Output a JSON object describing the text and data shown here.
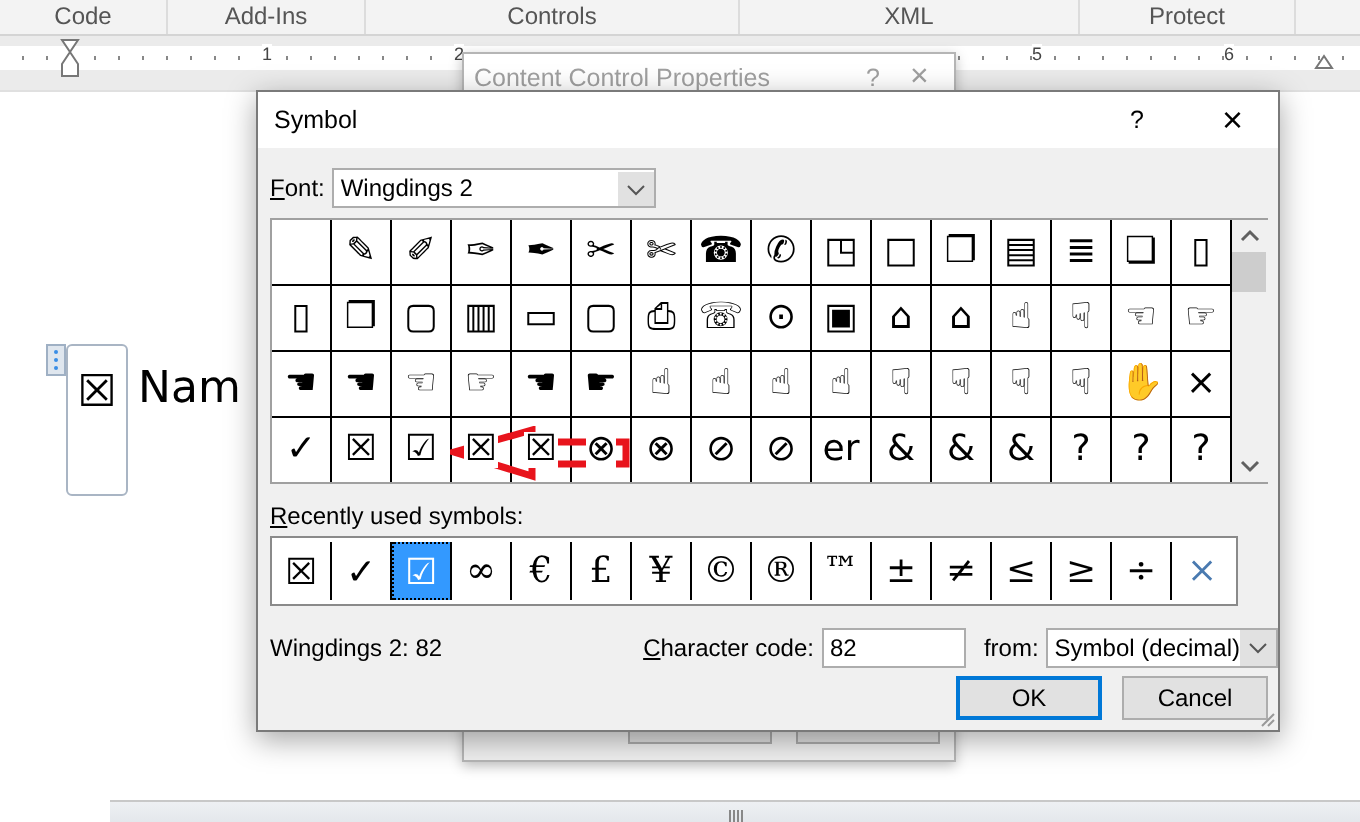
{
  "ribbon": {
    "groups": [
      "Code",
      "Add-Ins",
      "Controls",
      "XML",
      "Protect"
    ]
  },
  "ruler": {
    "numbers": [
      "1",
      "2",
      "5",
      "6"
    ]
  },
  "document": {
    "checkbox": "☒",
    "text": "Nam"
  },
  "background_dialog": {
    "title": "Content Control Properties",
    "help": "?",
    "close": "×"
  },
  "symbol_dialog": {
    "title": "Symbol",
    "help": "?",
    "close": "×",
    "font_label": "Font:",
    "font_value": "Wingdings 2",
    "grid": [
      [
        {
          "kind": "empty"
        },
        "✎",
        "✐",
        "✑",
        "✒",
        "✂",
        "✄",
        "☎",
        "✆",
        "◳",
        "□",
        "❐",
        "▤",
        "≣",
        "❏",
        "▯"
      ],
      [
        "▯",
        "❐",
        "▢",
        "▥",
        "▭",
        "▢",
        "⎙",
        "☏",
        "⊙",
        "▣",
        "⌂",
        "⌂",
        "☝",
        "☟",
        "☜",
        "☞"
      ],
      [
        "☚",
        "☚",
        "☜",
        "☞",
        "☚",
        "☛",
        "☝",
        "☝",
        "☝",
        "☝",
        "☟",
        "☟",
        "☟",
        "☟",
        "✋",
        "×"
      ],
      [
        "✓",
        "☒",
        "☑",
        "☒",
        "☒",
        "⊗",
        "⊗",
        "⊘",
        "⊘",
        "er",
        "&",
        "&",
        "&",
        "?",
        "?",
        "?"
      ]
    ],
    "recent_label": "Recently used symbols:",
    "recent": [
      {
        "symbol": "☒",
        "selected": false
      },
      {
        "symbol": "✓",
        "selected": false
      },
      {
        "symbol": "☑",
        "selected": true
      },
      {
        "symbol": "∞",
        "selected": false
      },
      {
        "symbol": "€",
        "selected": false
      },
      {
        "symbol": "£",
        "selected": false
      },
      {
        "symbol": "¥",
        "selected": false
      },
      {
        "symbol": "©",
        "selected": false
      },
      {
        "symbol": "®",
        "selected": false
      },
      {
        "symbol": "™",
        "selected": false
      },
      {
        "symbol": "±",
        "selected": false
      },
      {
        "symbol": "≠",
        "selected": false
      },
      {
        "symbol": "≤",
        "selected": false
      },
      {
        "symbol": "≥",
        "selected": false
      },
      {
        "symbol": "÷",
        "selected": false
      },
      {
        "symbol": "×",
        "selected": false
      }
    ],
    "info": "Wingdings 2: 82",
    "code_label": "Character code:",
    "code_value": "82",
    "from_label": "from:",
    "from_value": "Symbol (decimal)",
    "buttons": [
      {
        "label": "OK",
        "default": true
      },
      {
        "label": "Cancel",
        "default": false
      }
    ]
  }
}
